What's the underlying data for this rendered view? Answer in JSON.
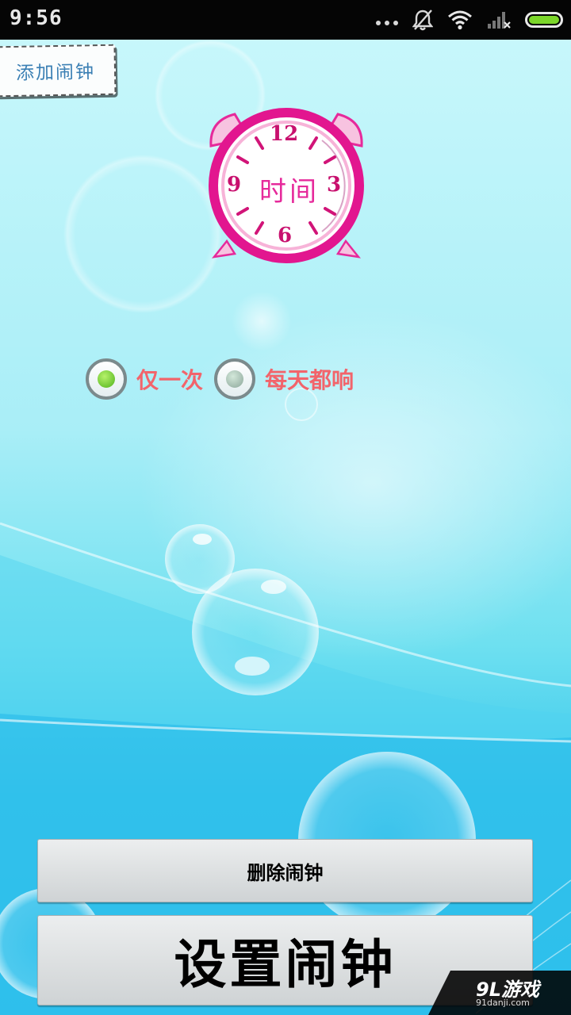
{
  "status_bar": {
    "time": "9:56",
    "battery_level": 1.0,
    "icons": [
      "more-dots-icon",
      "alarm-off-icon",
      "wifi-icon",
      "signal-no-sim-icon",
      "battery-icon"
    ]
  },
  "add_alarm": {
    "label": "添加闹钟"
  },
  "clock": {
    "label": "时间",
    "numbers": {
      "twelve": "12",
      "three": "3",
      "six": "6",
      "nine": "9"
    }
  },
  "repeat": {
    "selected": "once",
    "options": [
      {
        "id": "once",
        "label": "仅一次"
      },
      {
        "id": "daily",
        "label": "每天都响"
      }
    ]
  },
  "buttons": {
    "delete_label": "删除闹钟",
    "set_label": "设置闹钟"
  },
  "watermark": {
    "brand": "9L游戏",
    "domain": "91danji.com"
  },
  "colors": {
    "accent_pink": "#e62a9b",
    "radio_label": "#f2646b",
    "radio_selected": "#4fb21c",
    "battery": "#7cd62a"
  }
}
